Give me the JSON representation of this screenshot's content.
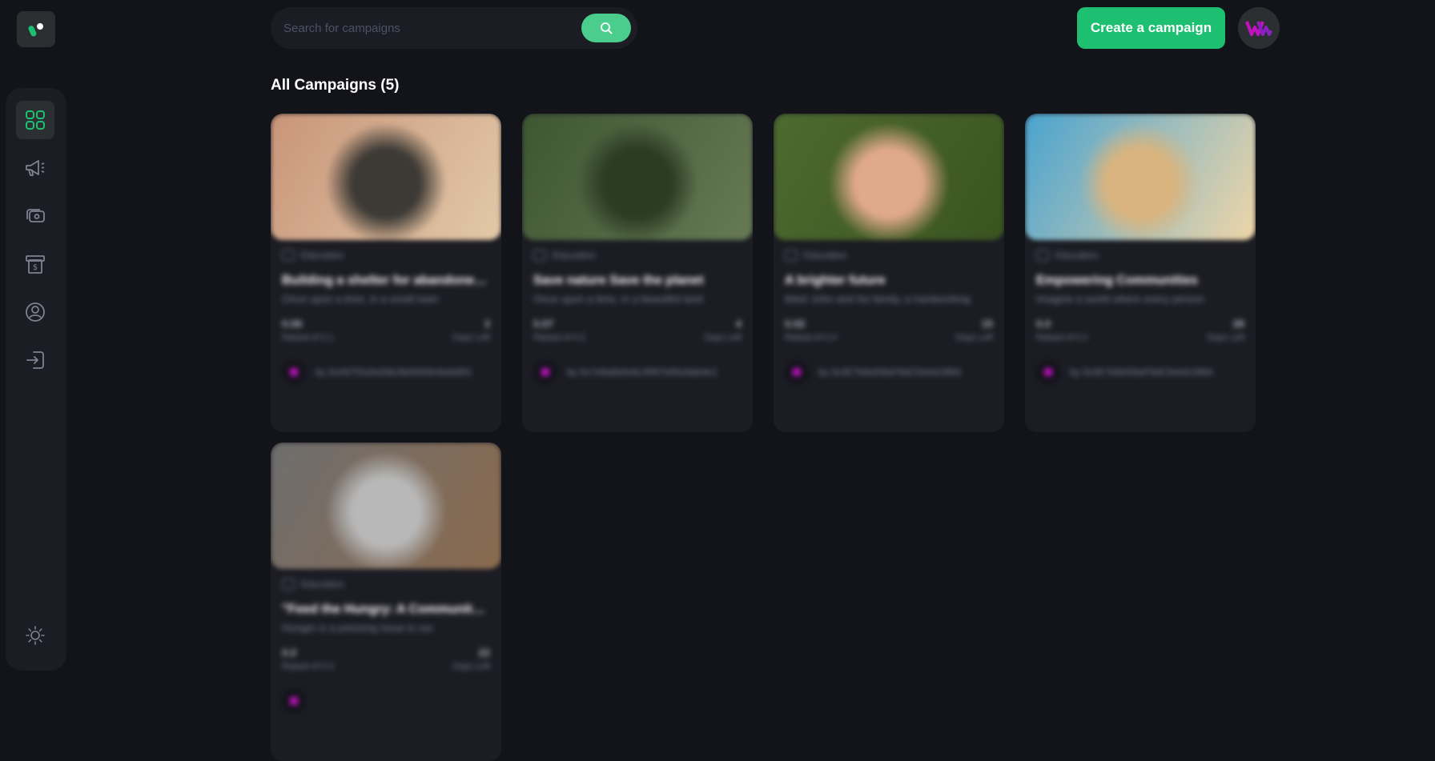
{
  "app": {
    "logo_icon": "app-logo-icon"
  },
  "sidebar": {
    "items": [
      {
        "name": "dashboard",
        "icon": "grid-icon",
        "active": true
      },
      {
        "name": "campaign",
        "icon": "megaphone-icon",
        "active": false
      },
      {
        "name": "payment",
        "icon": "wallet-icon",
        "active": false
      },
      {
        "name": "withdraw",
        "icon": "receipt-icon",
        "active": false
      },
      {
        "name": "profile",
        "icon": "user-circle-icon",
        "active": false
      },
      {
        "name": "logout",
        "icon": "logout-icon",
        "active": false
      }
    ],
    "theme_icon": "sun-icon"
  },
  "search": {
    "placeholder": "Search for campaigns",
    "icon": "search-icon"
  },
  "header": {
    "create_label": "Create a campaign",
    "avatar_icon": "brand-avatar-icon"
  },
  "main": {
    "title": "All Campaigns (5)",
    "campaigns": [
      {
        "category": "Education",
        "title": "Building a shelter for abandoned animals",
        "description": "Once upon a time, in a small town",
        "raised": "0.06",
        "raised_label": "Raised of 0.1",
        "days": "3",
        "days_label": "Days Left",
        "owner": "by 0xA97f3c6eD8e3b00fA9c8e6d0f1",
        "image_colors": [
          "#c9957a",
          "#3d3a35",
          "#e2c9a8"
        ]
      },
      {
        "category": "Education",
        "title": "Save nature Save the planet",
        "description": "Once upon a time, in a beautiful land",
        "raised": "0.07",
        "raised_label": "Raised of 0.2",
        "days": "4",
        "days_label": "Days Left",
        "owner": "by 0x7e8a8a5e6c3f4f7d45e9ab4e1",
        "image_colors": [
          "#3e5632",
          "#2b3b24",
          "#657a55"
        ]
      },
      {
        "category": "Education",
        "title": "A brighter future",
        "description": "Meet John and his family, a hardworking",
        "raised": "0.02",
        "raised_label": "Raised of 0.4",
        "days": "15",
        "days_label": "Days Left",
        "owner": "by 0x3E7b9eD8aF9dC0eb4c5f6A",
        "image_colors": [
          "#4d6a2f",
          "#e0a989",
          "#3a5420"
        ]
      },
      {
        "category": "Education",
        "title": "Empowering Communities",
        "description": "Imagine a world where every person",
        "raised": "0.0",
        "raised_label": "Raised of 0.1",
        "days": "28",
        "days_label": "Days Left",
        "owner": "by 0x3E7b9eD8aF9dC0eb4c5f6A",
        "image_colors": [
          "#4aa3cf",
          "#d9b47e",
          "#f0d6a8"
        ]
      },
      {
        "category": "Education",
        "title": "\"Feed the Hungry: A Community Effort",
        "description": "Hunger is a pressing issue in our",
        "raised": "0.0",
        "raised_label": "Raised of 0.3",
        "days": "22",
        "days_label": "Days Left",
        "owner": "",
        "image_colors": [
          "#6e6e6e",
          "#b8b8b8",
          "#8a6a4e"
        ]
      }
    ]
  }
}
